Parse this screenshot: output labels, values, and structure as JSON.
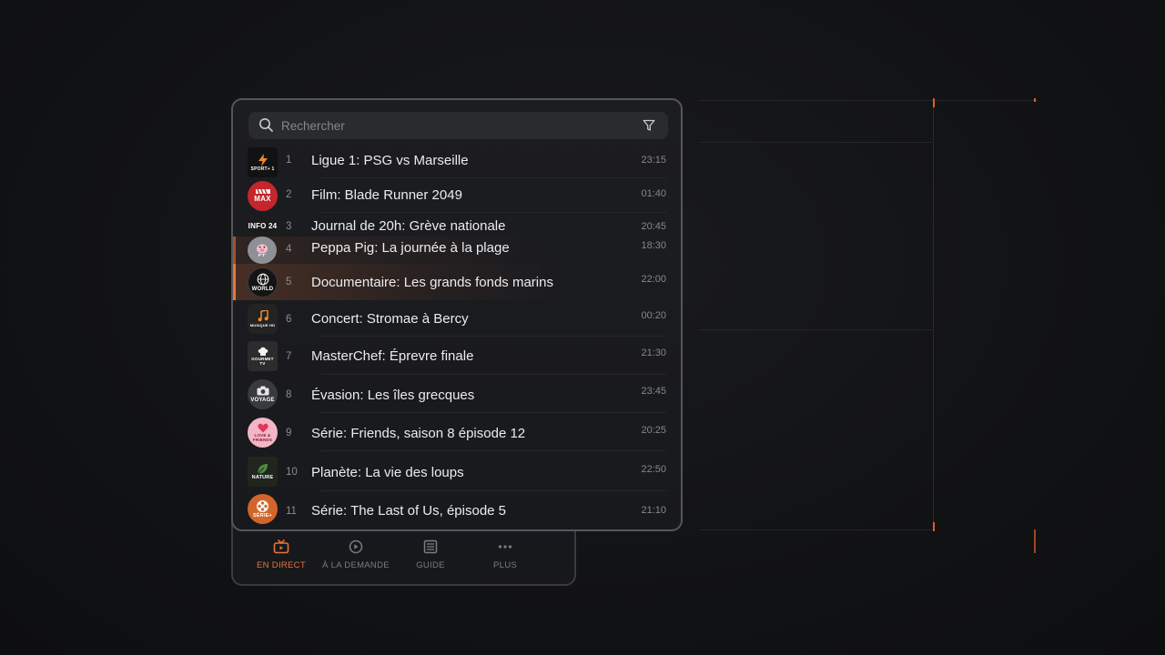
{
  "search": {
    "placeholder": "Rechercher"
  },
  "channels": [
    {
      "num": "1",
      "title": "Ligue 1: PSG vs Marseille",
      "time": "23:15",
      "logo_icon": "bolt-icon",
      "logo_text": "SPORT+ 1",
      "logo_color": "#121212"
    },
    {
      "num": "2",
      "title": "Film: Blade Runner 2049",
      "time": "01:40",
      "logo_icon": "clapperboard-icon",
      "logo_text": "MAX",
      "logo_color": "#c4262b"
    },
    {
      "num": "3",
      "title": "Journal de 20h: Grève nationale",
      "time": "20:45",
      "logo_icon": "none",
      "logo_text": "INFO 24",
      "logo_color": "#1c1c1c"
    },
    {
      "num": "4",
      "title": "Peppa Pig: La journée à la plage",
      "time": "18:30",
      "logo_icon": "pig-icon",
      "logo_text": "P'T'",
      "logo_color": "#8f9096"
    },
    {
      "num": "5",
      "title": "Documentaire: Les grands fonds marins",
      "time": "22:00",
      "logo_icon": "globe-icon",
      "logo_text": "WORLD",
      "logo_color": "#141414"
    },
    {
      "num": "6",
      "title": "Concert: Stromae à Bercy",
      "time": "00:20",
      "logo_icon": "music-note-icon",
      "logo_text": "MUSIQUE HD",
      "logo_color": "#232323"
    },
    {
      "num": "7",
      "title": "MasterChef: Éprevre finale",
      "time": "21:30",
      "logo_icon": "chef-hat-icon",
      "logo_text": "GOURMET TV",
      "logo_color": "#2c2c2c"
    },
    {
      "num": "8",
      "title": "Évasion: Les îles grecques",
      "time": "23:45",
      "logo_icon": "camera-icon",
      "logo_text": "VOYAGE",
      "logo_color": "#393a3e"
    },
    {
      "num": "9",
      "title": "Série: Friends, saison 8 épisode 12",
      "time": "20:25",
      "logo_icon": "heart-icon",
      "logo_text": "LOVE & FRIENDS",
      "logo_color": "#f3b6c6"
    },
    {
      "num": "10",
      "title": "Planète: La vie des loups",
      "time": "22:50",
      "logo_icon": "leaf-icon",
      "logo_text": "NATURE",
      "logo_color": "#20261e"
    },
    {
      "num": "11",
      "title": "Série: The Last of Us, épisode 5",
      "time": "21:10",
      "logo_icon": "film-reel-icon",
      "logo_text": "SÉRIE+",
      "logo_color": "#d2652c"
    }
  ],
  "active_channel_num": "5",
  "nav": [
    {
      "label": "EN DIRECT",
      "icon": "tv-icon",
      "active": true
    },
    {
      "label": "À LA DEMANDE",
      "icon": "play-circle-icon",
      "active": false
    },
    {
      "label": "GUIDE",
      "icon": "guide-icon",
      "active": false
    },
    {
      "label": "PLUS",
      "icon": "more-icon",
      "active": false
    }
  ],
  "colors": {
    "accent": "#e8743a",
    "panel": "#1c1d21",
    "background": "#121315"
  }
}
